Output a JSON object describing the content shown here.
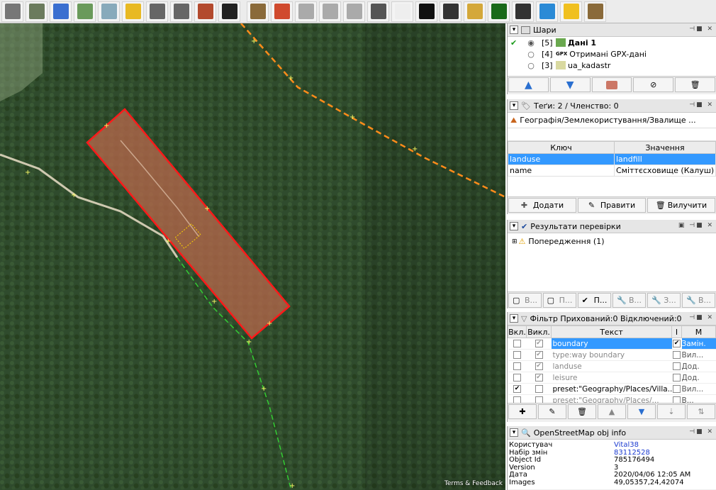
{
  "toolbar": {
    "icons": [
      "mapnik-icon",
      "gps-trace-icon",
      "refresh-icon",
      "cross-icon",
      "plus-map-icon",
      "road-yellow-icon",
      "road-grey-icon",
      "road-point-icon",
      "wall-icon",
      "car-icon",
      "factory-icon",
      "tree-color-icon",
      "house-icon",
      "house2-icon",
      "road-lines-icon",
      "road-dark-icon",
      "road-white-icon",
      "tractor-icon",
      "religion-icon",
      "wheat-icon",
      "forest-icon",
      "bridge-icon",
      "water-icon",
      "yellow-ring-icon",
      "factory2-icon"
    ]
  },
  "map": {
    "terms": "Terms & Feedback"
  },
  "layers": {
    "title": "Шари",
    "items": [
      {
        "num": "[5]",
        "name": "Дані 1",
        "bold": true
      },
      {
        "num": "[4]",
        "name": "Отримані GPX-дані",
        "prefix": "GPX"
      },
      {
        "num": "[3]",
        "name": "ua_kadastr"
      }
    ]
  },
  "tags": {
    "title": "Теґи: 2 / Членство: 0",
    "preset": "Географія/Землекористування/Звалище ...",
    "col_key": "Ключ",
    "col_value": "Значення",
    "rows": [
      {
        "key": "landuse",
        "value": "landfill"
      },
      {
        "key": "name",
        "value": "Сміттєсховище (Калуш)"
      }
    ],
    "add": "Додати",
    "edit": "Правити",
    "delete": "Вилучити"
  },
  "validation": {
    "title": "Результати перевірки",
    "warnings": "Попередження (1)",
    "btns": [
      "В...",
      "П...",
      "П...",
      "В...",
      "З...",
      "В..."
    ]
  },
  "filter": {
    "title": "Фільтр Прихований:0 Відключений:0",
    "col_on": "Вкл.",
    "col_off": "Викл.",
    "col_text": "Текст",
    "col_i": "I",
    "col_m": "M",
    "rows": [
      {
        "text": "boundary",
        "m": "Замін.",
        "sel": true
      },
      {
        "text": "type:way boundary",
        "m": "Вил..."
      },
      {
        "text": "landuse",
        "m": "Дод."
      },
      {
        "text": "leisure",
        "m": "Дод."
      },
      {
        "text": "preset:\"Geography/Places/Villa...",
        "m": "Вил...",
        "on": true
      },
      {
        "text": "preset:\"Geography/Places/...",
        "m": "В..."
      }
    ]
  },
  "objinfo": {
    "title": "OpenStreetMap obj info",
    "rows": [
      {
        "k": "Користувач",
        "v": "Vital38"
      },
      {
        "k": "Набір змін",
        "v": "83112528"
      },
      {
        "k": "Object Id",
        "v": "785176494"
      },
      {
        "k": "Version",
        "v": "3"
      },
      {
        "k": "Дата",
        "v": "2020/04/06 12:05 AM"
      },
      {
        "k": "Images",
        "v": "49,05357,24,42074"
      }
    ]
  }
}
